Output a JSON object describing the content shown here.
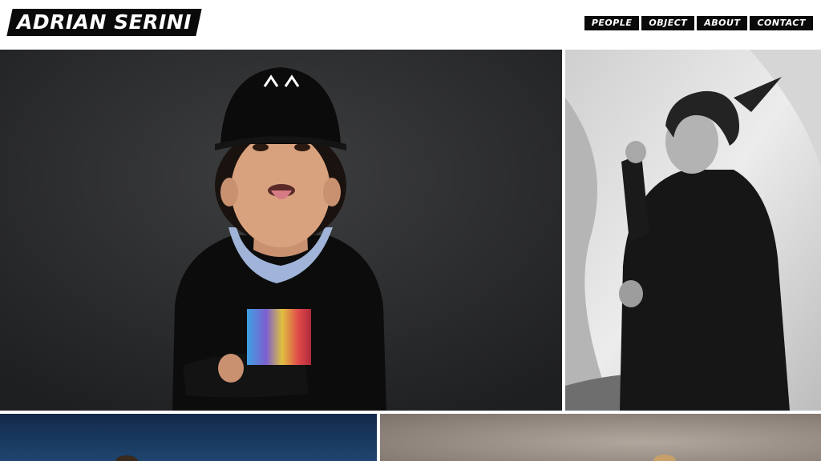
{
  "site": {
    "logo_text": "ADRIAN SERINI"
  },
  "nav": {
    "items": [
      "PEOPLE",
      "OBJECT",
      "ABOUT",
      "CONTACT"
    ]
  },
  "gallery": {
    "tiles": [
      {
        "subject": "boy-in-cap-portrait",
        "background": "#2c2d2f"
      },
      {
        "subject": "woman-in-black-coat-portrait",
        "background": "#d9d9d9"
      },
      {
        "subject": "blue-backdrop-portrait",
        "background": "#17324f"
      },
      {
        "subject": "beige-backdrop-portrait",
        "background": "#9c9187"
      }
    ]
  },
  "colors": {
    "brand": "#0a0a0a",
    "header_bg": "#ffffff"
  }
}
